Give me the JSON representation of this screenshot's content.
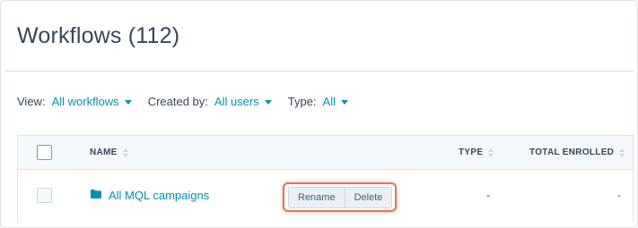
{
  "page": {
    "title": "Workflows (112)"
  },
  "filters": [
    {
      "label": "View:",
      "value": "All workflows"
    },
    {
      "label": "Created by:",
      "value": "All users"
    },
    {
      "label": "Type:",
      "value": "All"
    }
  ],
  "table": {
    "columns": {
      "name": "NAME",
      "type": "TYPE",
      "total_enrolled": "TOTAL ENROLLED"
    },
    "rows": [
      {
        "name": "All MQL campaigns",
        "icon": "folder-icon",
        "type": "-",
        "total_enrolled": "-",
        "actions": {
          "rename": "Rename",
          "delete": "Delete"
        }
      }
    ]
  },
  "colors": {
    "link": "#0091ae",
    "text": "#33475b",
    "highlight": "#e0765a",
    "header_bg": "#f5f8fa"
  }
}
